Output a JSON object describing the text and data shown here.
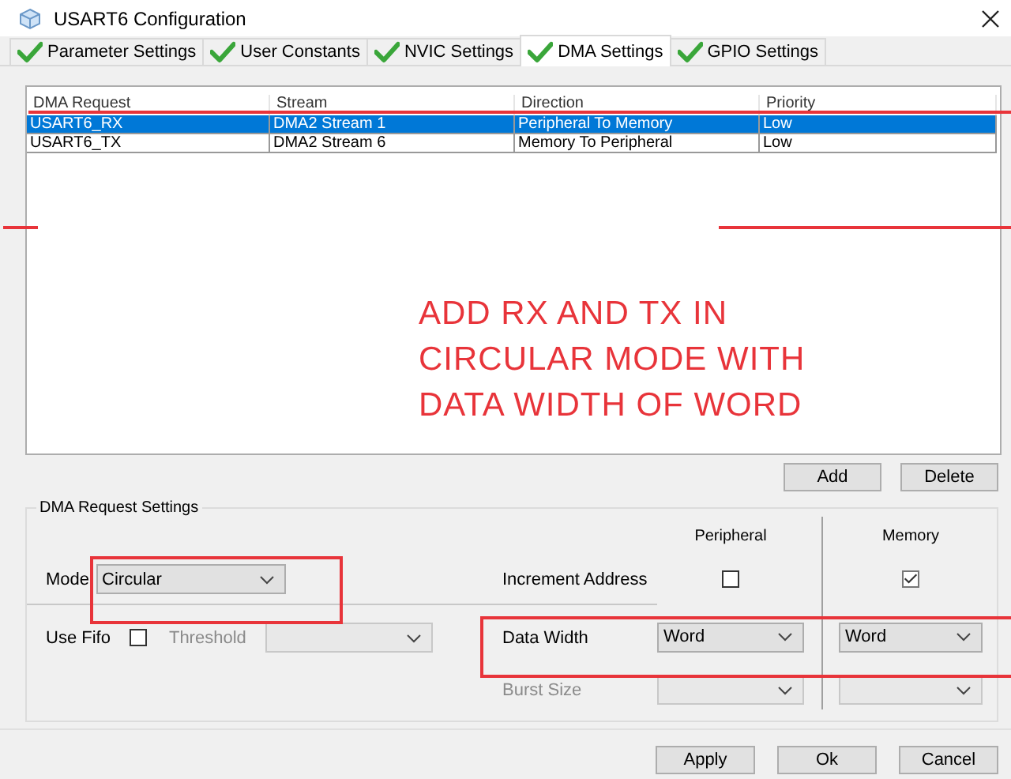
{
  "window": {
    "title": "USART6 Configuration"
  },
  "tabs": [
    {
      "label": "Parameter Settings",
      "selected": false
    },
    {
      "label": "User Constants",
      "selected": false
    },
    {
      "label": "NVIC Settings",
      "selected": false
    },
    {
      "label": "DMA Settings",
      "selected": true
    },
    {
      "label": "GPIO Settings",
      "selected": false
    }
  ],
  "table": {
    "columns": [
      "DMA Request",
      "Stream",
      "Direction",
      "Priority"
    ],
    "rows": [
      {
        "cells": [
          "USART6_RX",
          "DMA2 Stream 1",
          "Peripheral To Memory",
          "Low"
        ],
        "selected": true
      },
      {
        "cells": [
          "USART6_TX",
          "DMA2 Stream 6",
          "Memory To Peripheral",
          "Low"
        ],
        "selected": false
      }
    ]
  },
  "annotation": {
    "lines": [
      "ADD RX AND TX IN",
      "CIRCULAR MODE WITH",
      "DATA WIDTH OF WORD"
    ]
  },
  "table_buttons": [
    "Add",
    "Delete"
  ],
  "settings": {
    "title": "DMA Request Settings",
    "mode": {
      "label": "Mode",
      "value": "Circular"
    },
    "use_fifo": {
      "label": "Use Fifo",
      "checked": false
    },
    "threshold": {
      "label": "Threshold",
      "disabled": true
    },
    "columns": [
      "Peripheral",
      "Memory"
    ],
    "increment_address": {
      "label": "Increment Address",
      "peripheral": false,
      "memory": true
    },
    "data_width": {
      "label": "Data Width",
      "peripheral": "Word",
      "memory": "Word"
    },
    "burst_size": {
      "label": "Burst Size",
      "disabled": true
    }
  },
  "footer_buttons": [
    "Apply",
    "Ok",
    "Cancel"
  ]
}
